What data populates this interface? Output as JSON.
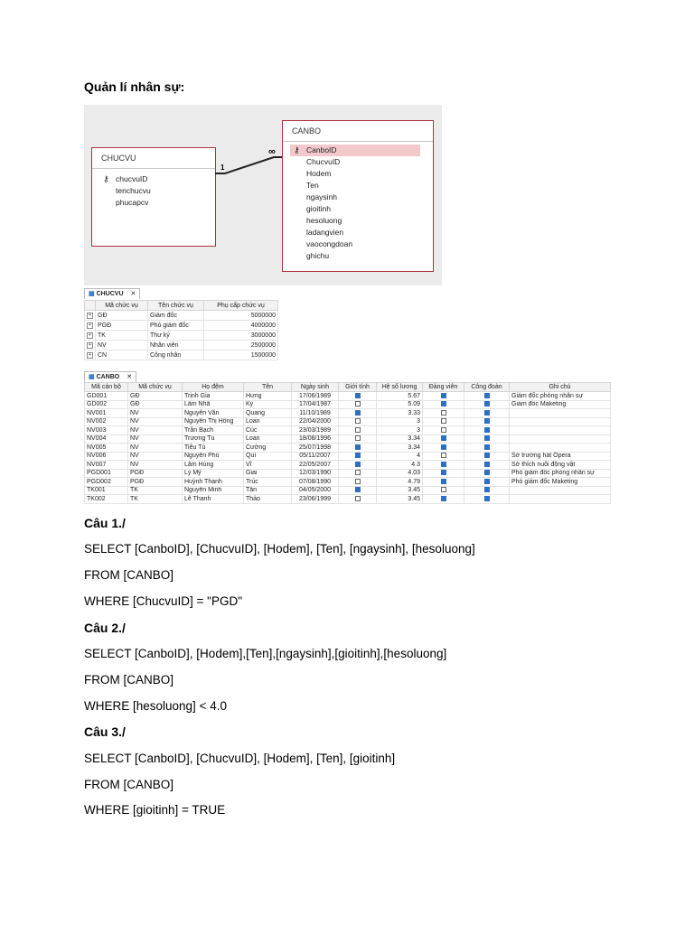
{
  "page_title": "Quản lí nhân sự:",
  "diagram": {
    "chucvu": {
      "title": "CHUCVU",
      "fields": [
        "chucvuID",
        "tenchucvu",
        "phucapcv"
      ]
    },
    "canbo": {
      "title": "CANBO",
      "fields": [
        "CanboID",
        "ChucvuID",
        "Hodem",
        "Ten",
        "ngaysinh",
        "gioitinh",
        "hesoluong",
        "ladangvien",
        "vaocongdoan",
        "ghichu"
      ]
    },
    "rel_one": "1",
    "rel_many": "∞"
  },
  "chucvu_sheet": {
    "tab": "CHUCVU",
    "close": "✕",
    "columns": [
      "",
      "Mã chức vụ",
      "Tên chức vụ",
      "Phụ cấp chức vụ"
    ],
    "rows": [
      [
        "GĐ",
        "Giám đốc",
        "5000000"
      ],
      [
        "PGĐ",
        "Phó giám đốc",
        "4000000"
      ],
      [
        "TK",
        "Thư ký",
        "3000000"
      ],
      [
        "NV",
        "Nhân viên",
        "2500000"
      ],
      [
        "CN",
        "Công nhân",
        "1500000"
      ]
    ]
  },
  "canbo_sheet": {
    "tab": "CANBO",
    "close": "✕",
    "columns": [
      "Mã cán bộ",
      "Mã chức vụ",
      "Họ đệm",
      "Tên",
      "Ngày sinh",
      "Giới tính",
      "Hệ số lương",
      "Đảng viên",
      "Công đoàn",
      "Ghi chú"
    ],
    "rows": [
      {
        "id": "GD001",
        "cv": "GĐ",
        "hodem": "Trịnh Gia",
        "ten": "Hưng",
        "ns": "17/06/1989",
        "gt": true,
        "hsl": "5.67",
        "dv": true,
        "cd": true,
        "gc": "Giám đốc phòng nhân sự"
      },
      {
        "id": "GD002",
        "cv": "GĐ",
        "hodem": "Lâm Nhã",
        "ten": "Kỳ",
        "ns": "17/04/1987",
        "gt": false,
        "hsl": "5.09",
        "dv": true,
        "cd": true,
        "gc": "Giám đốc Maketing"
      },
      {
        "id": "NV001",
        "cv": "NV",
        "hodem": "Nguyễn Văn",
        "ten": "Quang",
        "ns": "11/10/1989",
        "gt": true,
        "hsl": "3.33",
        "dv": false,
        "cd": true,
        "gc": ""
      },
      {
        "id": "NV002",
        "cv": "NV",
        "hodem": "Nguyễn Thị Hồng",
        "ten": "Loan",
        "ns": "22/04/2000",
        "gt": false,
        "hsl": "3",
        "dv": false,
        "cd": true,
        "gc": ""
      },
      {
        "id": "NV003",
        "cv": "NV",
        "hodem": "Trần Bạch",
        "ten": "Cúc",
        "ns": "23/03/1989",
        "gt": false,
        "hsl": "3",
        "dv": false,
        "cd": true,
        "gc": ""
      },
      {
        "id": "NV004",
        "cv": "NV",
        "hodem": "Trương Tú",
        "ten": "Loan",
        "ns": "18/08/1996",
        "gt": false,
        "hsl": "3.34",
        "dv": true,
        "cd": true,
        "gc": ""
      },
      {
        "id": "NV005",
        "cv": "NV",
        "hodem": "Tiêu Tú",
        "ten": "Cường",
        "ns": "25/07/1998",
        "gt": true,
        "hsl": "3.34",
        "dv": true,
        "cd": true,
        "gc": ""
      },
      {
        "id": "NV006",
        "cv": "NV",
        "hodem": "Nguyễn Phú",
        "ten": "Quí",
        "ns": "05/11/2007",
        "gt": true,
        "hsl": "4",
        "dv": false,
        "cd": true,
        "gc": "Sở trường hát Opera"
      },
      {
        "id": "NV007",
        "cv": "NV",
        "hodem": "Lâm Hùng",
        "ten": "Vĩ",
        "ns": "22/05/2007",
        "gt": true,
        "hsl": "4.3",
        "dv": true,
        "cd": true,
        "gc": "Sở thích nuôi động vật"
      },
      {
        "id": "PGD001",
        "cv": "PGĐ",
        "hodem": "Lý Mỹ",
        "ten": "Giai",
        "ns": "12/03/1990",
        "gt": false,
        "hsl": "4.03",
        "dv": true,
        "cd": true,
        "gc": "Phó giám đốc phòng nhân sự"
      },
      {
        "id": "PGD002",
        "cv": "PGĐ",
        "hodem": "Huỳnh Thanh",
        "ten": "Trúc",
        "ns": "07/08/1990",
        "gt": false,
        "hsl": "4.79",
        "dv": true,
        "cd": true,
        "gc": "Phó giám đốc Maketing"
      },
      {
        "id": "TK001",
        "cv": "TK",
        "hodem": "Nguyễn Minh",
        "ten": "Tân",
        "ns": "04/05/2000",
        "gt": true,
        "hsl": "3.45",
        "dv": false,
        "cd": true,
        "gc": ""
      },
      {
        "id": "TK002",
        "cv": "TK",
        "hodem": "Lê Thanh",
        "ten": "Thảo",
        "ns": "23/06/1999",
        "gt": false,
        "hsl": "3.45",
        "dv": true,
        "cd": true,
        "gc": ""
      }
    ]
  },
  "questions": [
    {
      "heading": "Câu 1./",
      "lines": [
        "SELECT [CanboID], [ChucvuID], [Hodem], [Ten], [ngaysinh], [hesoluong]",
        "FROM [CANBO]",
        "WHERE [ChucvuID] = \"PGD\""
      ]
    },
    {
      "heading": "Câu 2./",
      "lines": [
        "SELECT [CanboID], [Hodem],[Ten],[ngaysinh],[gioitinh],[hesoluong]",
        "FROM [CANBO]",
        "WHERE [hesoluong] < 4.0"
      ]
    },
    {
      "heading": "Câu 3./",
      "lines": [
        "SELECT [CanboID], [ChucvuID], [Hodem], [Ten], [gioitinh]",
        "FROM [CANBO]",
        "WHERE [gioitinh] = TRUE"
      ]
    }
  ]
}
